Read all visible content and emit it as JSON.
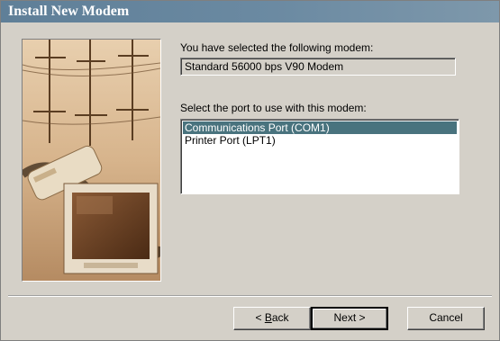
{
  "window": {
    "title": "Install New Modem"
  },
  "content": {
    "selected_label": "You have selected the following modem:",
    "modem_name": "Standard 56000 bps V90 Modem",
    "port_label": "Select the port to use with this modem:",
    "ports": [
      {
        "label": "Communications Port (COM1)",
        "selected": true
      },
      {
        "label": "Printer Port (LPT1)",
        "selected": false
      }
    ]
  },
  "buttons": {
    "back_prefix": "< ",
    "back_accel": "B",
    "back_rest": "ack",
    "next_label": "Next >",
    "cancel_label": "Cancel"
  },
  "colors": {
    "dialog_bg": "#d4d0c8",
    "title_bg": "#6b8aa2",
    "selection": "#49737e"
  }
}
